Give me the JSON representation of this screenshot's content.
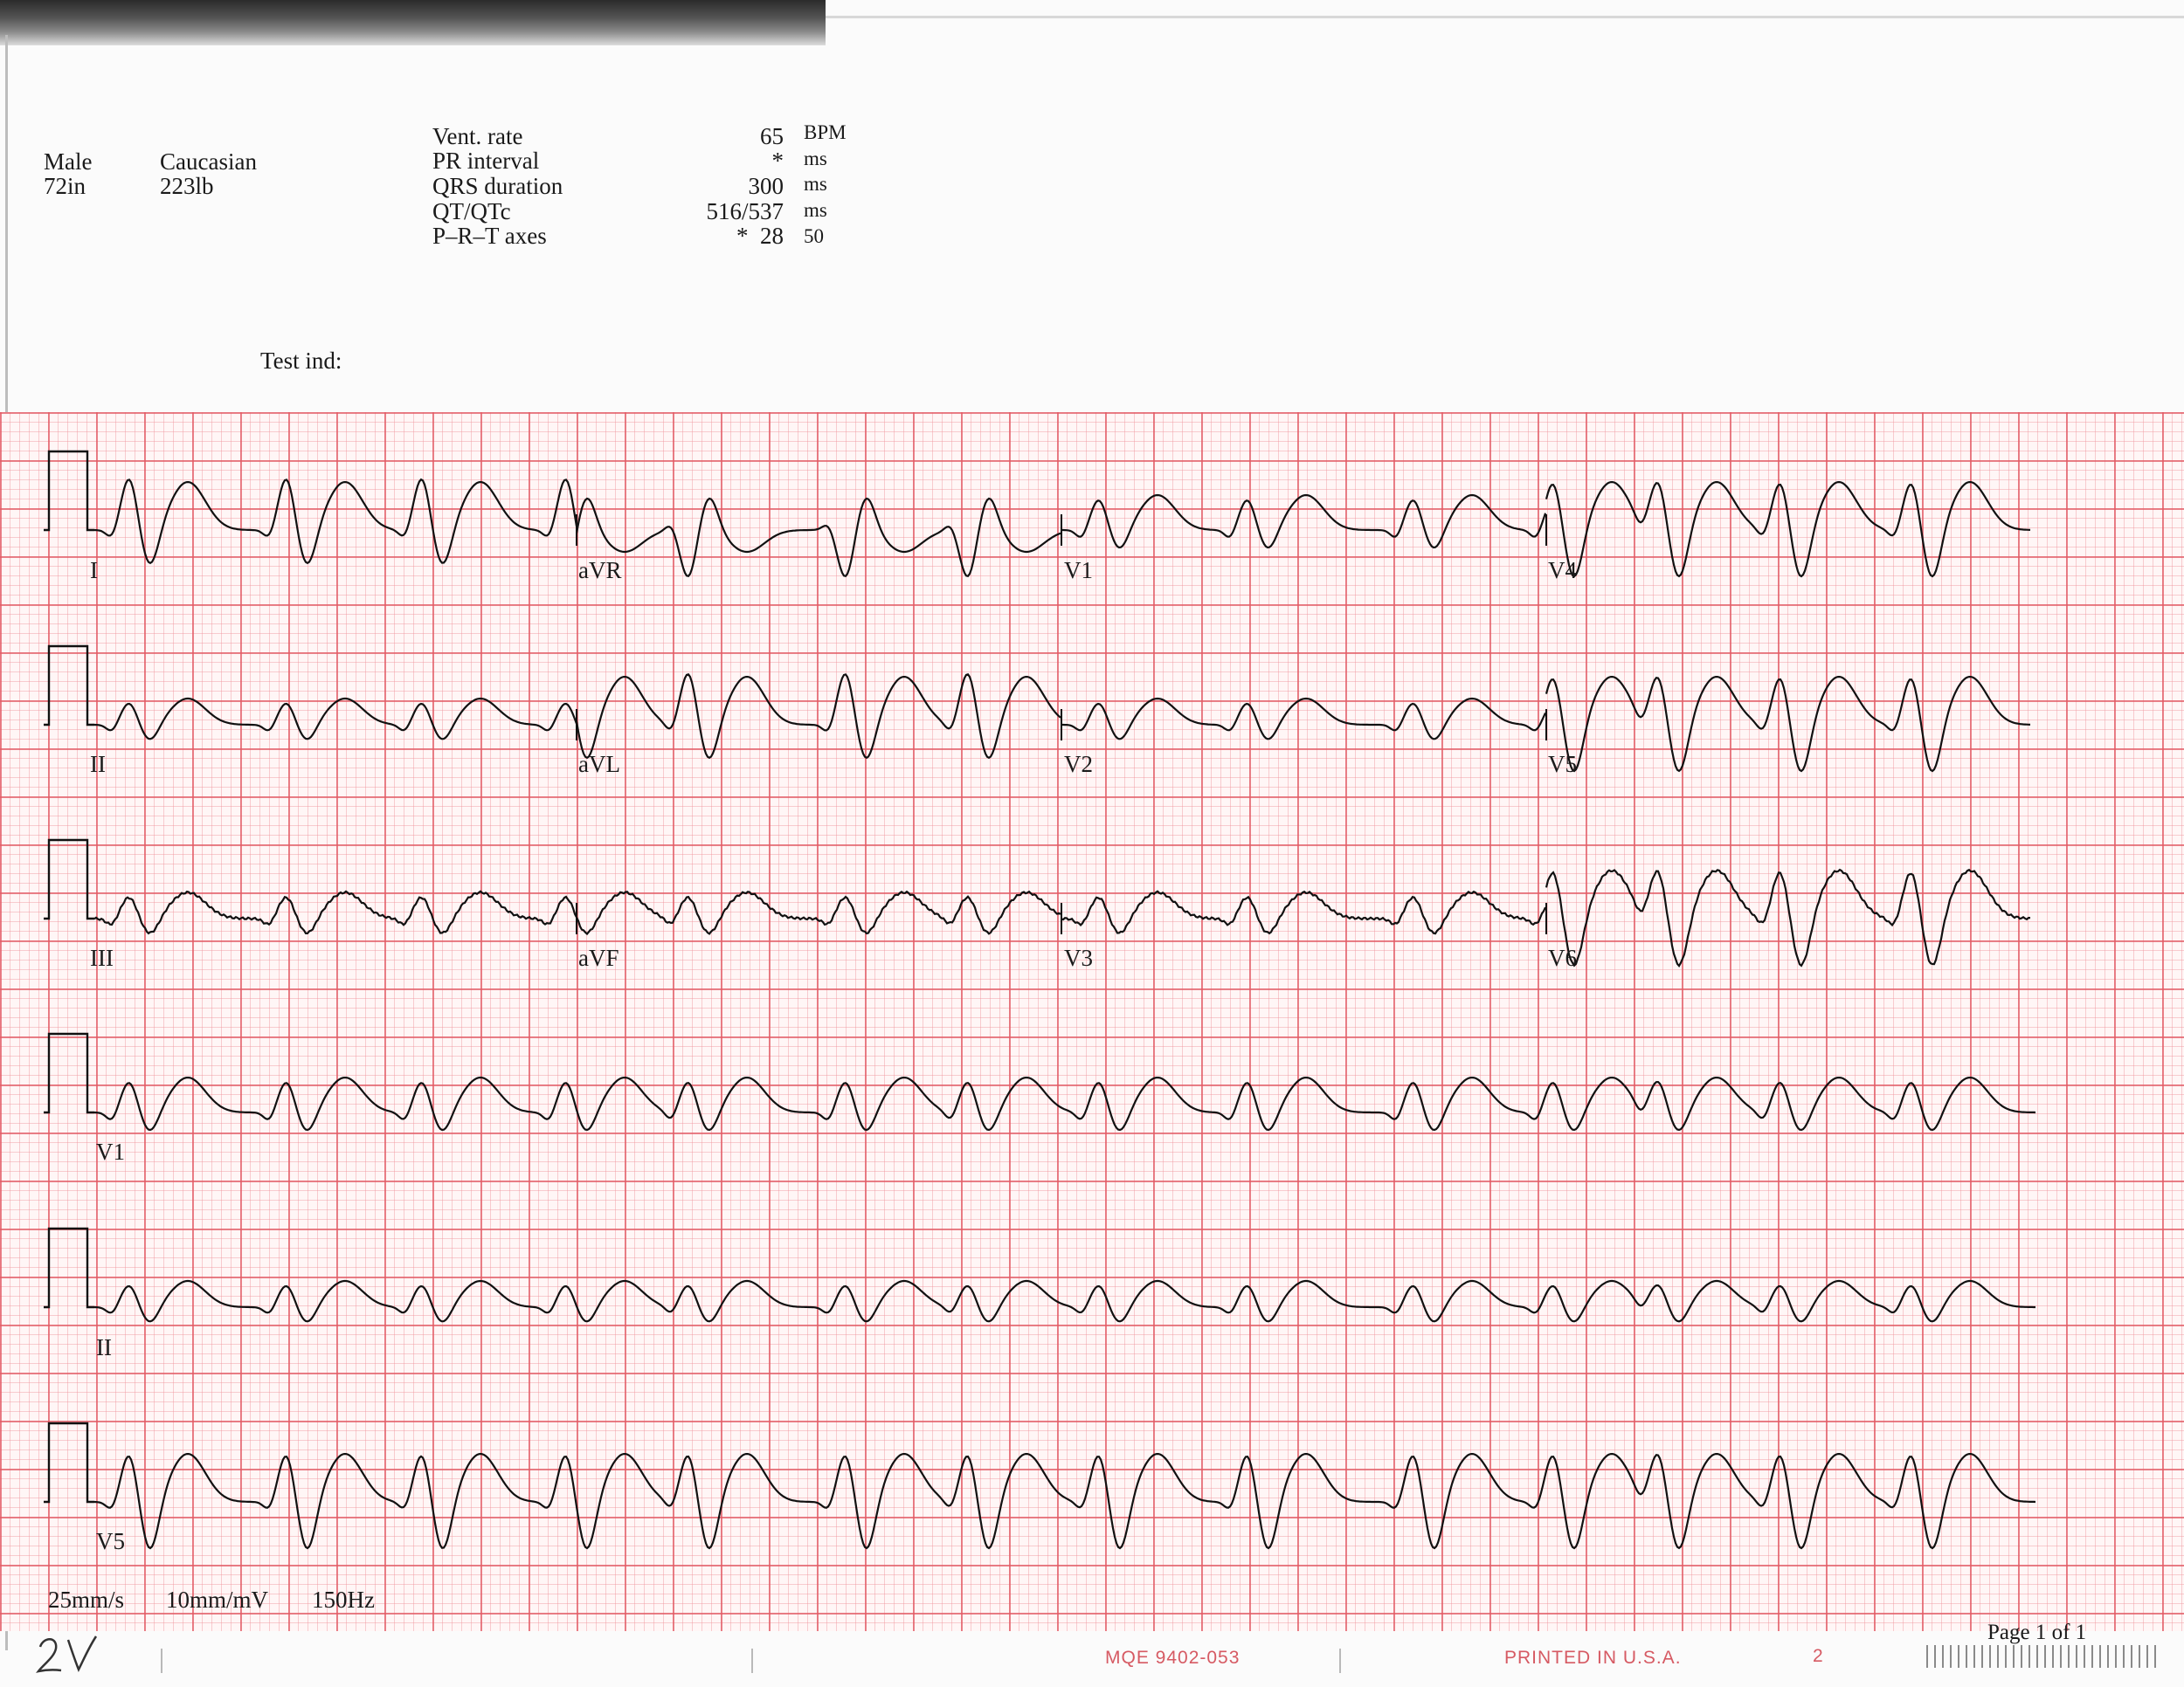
{
  "patient": {
    "sex": "Male",
    "height": "72in",
    "race": "Caucasian",
    "weight": "223lb"
  },
  "measurements": [
    {
      "label": "Vent. rate",
      "value": "65",
      "unit": "BPM"
    },
    {
      "label": "PR interval",
      "value": "*",
      "unit": "ms"
    },
    {
      "label": "QRS duration",
      "value": "300",
      "unit": "ms"
    },
    {
      "label": "QT/QTc",
      "value": "516/537",
      "unit": "ms"
    },
    {
      "label": "P–R–T axes",
      "value": "*  28",
      "unit": "50"
    }
  ],
  "test_ind_label": "Test ind:",
  "leads": {
    "row1": [
      "I",
      "aVR",
      "V1",
      "V4"
    ],
    "row2": [
      "II",
      "aVL",
      "V2",
      "V5"
    ],
    "row3": [
      "III",
      "aVF",
      "V3",
      "V6"
    ],
    "rhythm": [
      "V1",
      "II",
      "V5"
    ]
  },
  "settings": {
    "speed": "25mm/s",
    "gain": "10mm/mV",
    "filter": "150Hz"
  },
  "footer": {
    "handwritten": "2V",
    "form_code": "MQE  9402-053",
    "printed": "PRINTED IN U.S.A.",
    "number": "2",
    "page": "Page 1 of 1"
  },
  "colors": {
    "grid_major": "#e25a64",
    "grid_minor": "#f0969e",
    "trace": "#111111",
    "footer_text": "#d65a63"
  }
}
